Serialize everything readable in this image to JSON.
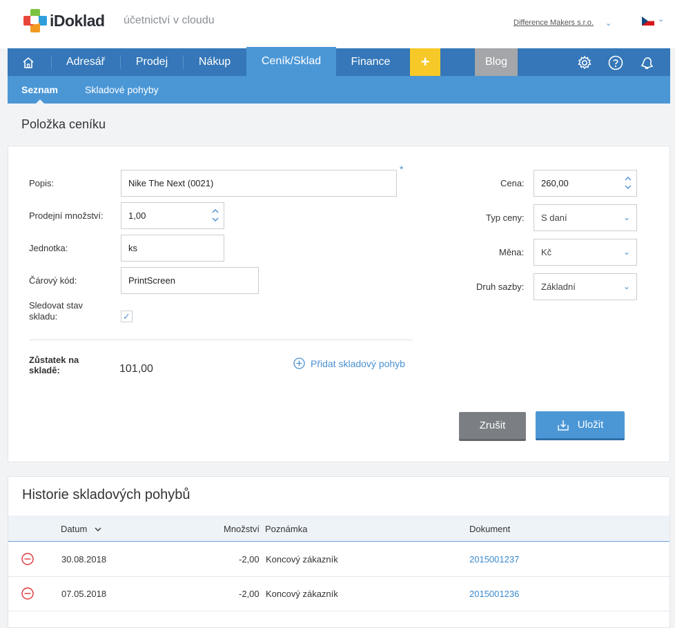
{
  "app": {
    "logo_text": "iDoklad",
    "tagline": "účetnictví v cloudu",
    "company": "Difference Makers s.r.o."
  },
  "nav": {
    "items": [
      {
        "label": "Adresář"
      },
      {
        "label": "Prodej"
      },
      {
        "label": "Nákup"
      },
      {
        "label": "Ceník/Sklad"
      },
      {
        "label": "Finance"
      }
    ],
    "plus_label": "+",
    "blog_label": "Blog"
  },
  "subnav": {
    "items": [
      {
        "label": "Seznam"
      },
      {
        "label": "Skladové pohyby"
      }
    ]
  },
  "page": {
    "title": "Položka ceníku"
  },
  "form": {
    "popis_label": "Popis:",
    "popis_value": "Nike The Next (0021)",
    "required_mark": "*",
    "mnozstvi_label": "Prodejní množství:",
    "mnozstvi_value": "1,00",
    "jednotka_label": "Jednotka:",
    "jednotka_value": "ks",
    "kod_label": "Čárový kód:",
    "kod_value": "PrintScreen",
    "sledovat_label_1": "Sledovat stav",
    "sledovat_label_2": "skladu:",
    "sledovat_checked": true,
    "check_glyph": "✓",
    "zustatek_label_1": "Zůstatek na",
    "zustatek_label_2": "skladě:",
    "zustatek_value": "101,00",
    "pridat_label": "Přidat skladový pohyb",
    "cena_label": "Cena:",
    "cena_value": "260,00",
    "typ_label": "Typ ceny:",
    "typ_value": "S daní",
    "mena_label": "Měna:",
    "mena_value": "Kč",
    "druh_label": "Druh sazby:",
    "druh_value": "Základní",
    "cancel_label": "Zrušit",
    "save_label": "Uložit"
  },
  "history": {
    "title": "Historie skladových pohybů",
    "columns": {
      "datum": "Datum",
      "mnozstvi": "Množství",
      "poznamka": "Poznámka",
      "dokument": "Dokument"
    },
    "rows": [
      {
        "datum": "30.08.2018",
        "mnozstvi": "-2,00",
        "poznamka": "Koncový zákazník",
        "dokument": "2015001237"
      },
      {
        "datum": "07.05.2018",
        "mnozstvi": "-2,00",
        "poznamka": "Koncový zákazník",
        "dokument": "2015001236"
      }
    ]
  },
  "colors": {
    "nav": "#3577b8",
    "subnav": "#4b97d6",
    "accent": "#4a8fd0",
    "plus": "#f7c928",
    "blog": "#a4a6a9",
    "danger": "#e0343a",
    "cancel": "#7b7f84"
  }
}
